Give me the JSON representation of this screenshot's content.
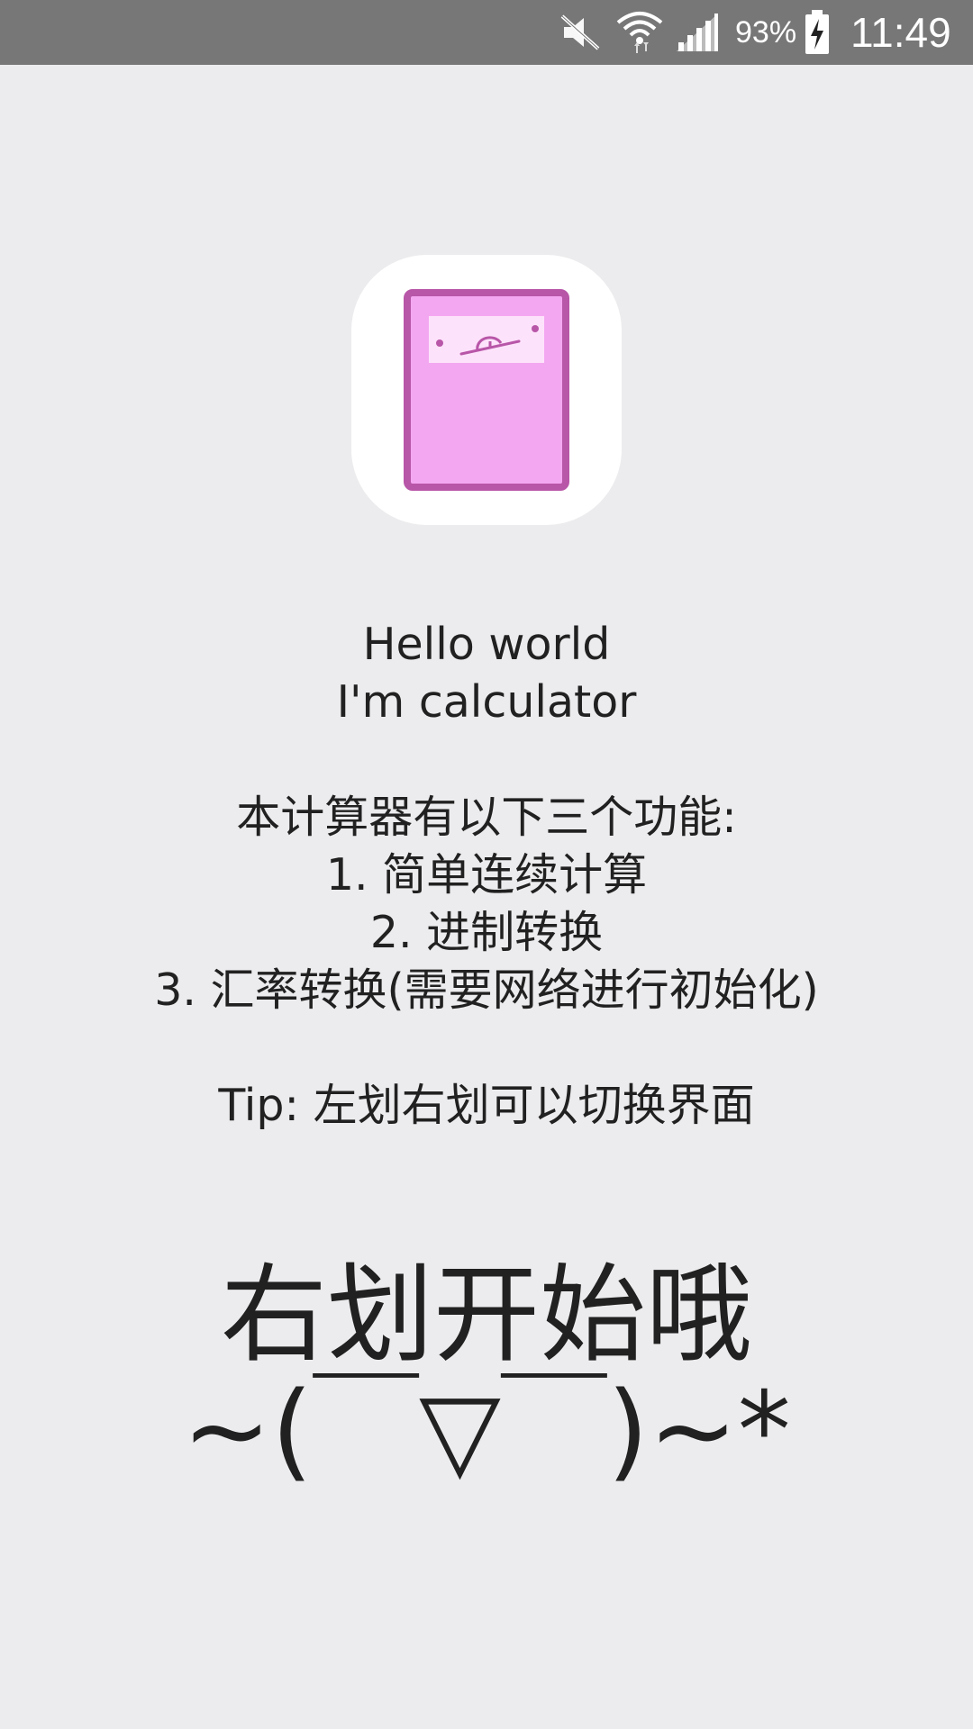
{
  "status_bar": {
    "battery_percent": "93%",
    "time": "11:49",
    "background_color": "#777777",
    "icons": [
      "mute-icon",
      "wifi-icon",
      "signal-icon",
      "battery-charging-icon"
    ]
  },
  "app_icon": {
    "name": "calculator-meter-icon",
    "primary_color": "#f4a7f1",
    "border_color": "#b856a8"
  },
  "intro": {
    "line1": "Hello world",
    "line2": "I'm calculator",
    "line3": "",
    "line4": "本计算器有以下三个功能:",
    "line5": "1. 简单连续计算",
    "line6": "2. 进制转换",
    "line7": "3. 汇率转换(需要网络进行初始化)",
    "line8": "",
    "line9": "Tip: 左划右划可以切换界面"
  },
  "swipe_hint": {
    "line1": "右划开始哦",
    "line2": "~(￣▽￣)~*"
  }
}
